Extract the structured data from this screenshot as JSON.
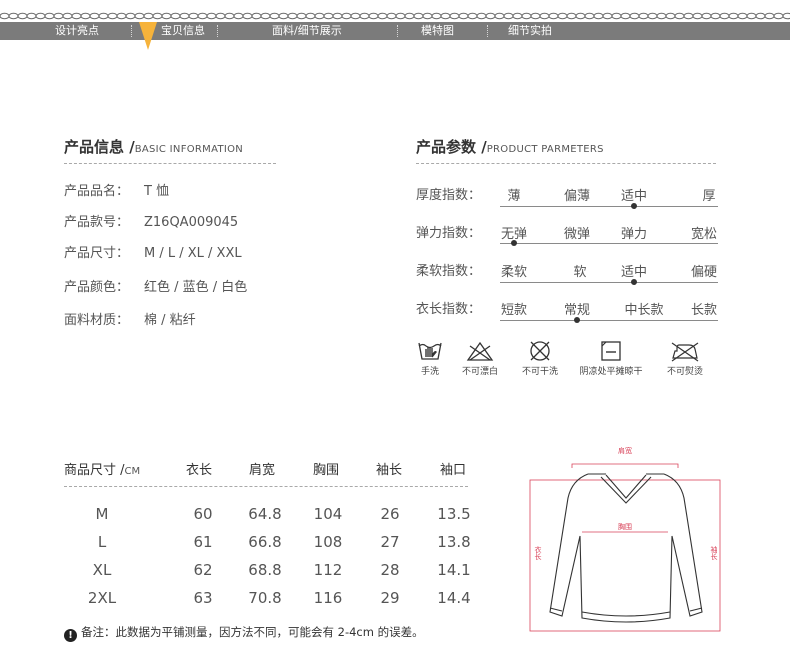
{
  "nav": {
    "items": [
      "设计亮点",
      "宝贝信息",
      "面料/细节展示",
      "模特图",
      "细节实拍"
    ],
    "active_index": 1,
    "bar_color": "#7b7b7b",
    "accent_color": "#f6b33b"
  },
  "basic_info": {
    "title": "产品信息 /",
    "subtitle": "BASIC INFORMATION",
    "rows": [
      {
        "label": "产品品名：",
        "value": "T 恤"
      },
      {
        "label": "产品款号：",
        "value": "Z16QA009045"
      },
      {
        "label": "产品尺寸：",
        "value": "M / L / XL / XXL"
      },
      {
        "label": "产品颜色：",
        "value": "红色 / 蓝色 / 白色"
      },
      {
        "label": "面料材质：",
        "value": "棉 / 粘纤"
      }
    ]
  },
  "parameters": {
    "title": "产品参数 /",
    "subtitle": "PRODUCT PARMETERS",
    "rows": [
      {
        "label": "厚度指数：",
        "options": [
          "薄",
          "偏薄",
          "适中",
          "厚"
        ],
        "selected": 2
      },
      {
        "label": "弹力指数：",
        "options": [
          "无弹",
          "微弹",
          "弹力",
          "宽松"
        ],
        "selected": 0
      },
      {
        "label": "柔软指数：",
        "options": [
          "柔软",
          "软",
          "适中",
          "偏硬"
        ],
        "selected": 2
      },
      {
        "label": "衣长指数：",
        "options": [
          "短款",
          "常规",
          "中长款",
          "长款"
        ],
        "selected": 1
      }
    ]
  },
  "care": [
    {
      "icon": "hand-wash-icon",
      "label": "手洗"
    },
    {
      "icon": "no-bleach-icon",
      "label": "不可漂白"
    },
    {
      "icon": "no-dry-clean-icon",
      "label": "不可干洗"
    },
    {
      "icon": "shade-flat-dry-icon",
      "label": "阴凉处平摊晾干"
    },
    {
      "icon": "no-iron-icon",
      "label": "不可熨烫"
    }
  ],
  "size_table": {
    "size_header": "商品尺寸 /",
    "unit": "CM",
    "columns": [
      "衣长",
      "肩宽",
      "胸围",
      "袖长",
      "袖口"
    ],
    "rows": [
      {
        "size": "M",
        "values": [
          "60",
          "64.8",
          "104",
          "26",
          "13.5"
        ]
      },
      {
        "size": "L",
        "values": [
          "61",
          "66.8",
          "108",
          "27",
          "13.8"
        ]
      },
      {
        "size": "XL",
        "values": [
          "62",
          "68.8",
          "112",
          "28",
          "14.1"
        ]
      },
      {
        "size": "2XL",
        "values": [
          "63",
          "70.8",
          "116",
          "29",
          "14.4"
        ]
      }
    ]
  },
  "note": "备注：此数据为平铺测量，因方法不同，可能会有 2-4cm 的误差。",
  "diagram": {
    "shoulder": "肩宽",
    "chest": "胸围",
    "length": "衣长",
    "sleeve": "袖长",
    "measure_color": "#d9435a"
  }
}
